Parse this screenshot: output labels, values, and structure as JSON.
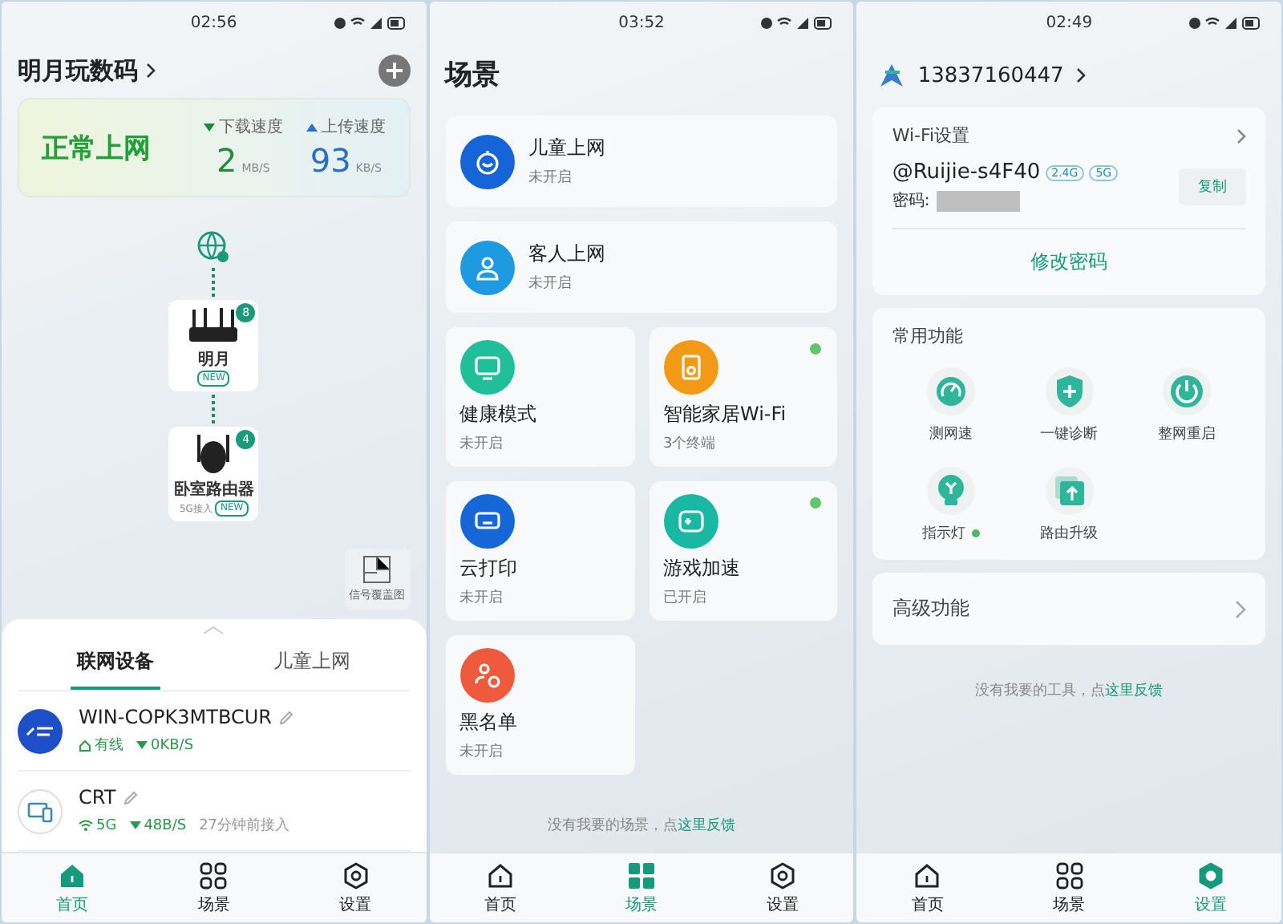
{
  "home": {
    "status_bar": {
      "time": "02:56"
    },
    "title": "明月玩数码",
    "summary": {
      "state": "正常上网",
      "download": {
        "label": "下载速度",
        "value": "2",
        "unit": "MB/S"
      },
      "upload": {
        "label": "上传速度",
        "value": "93",
        "unit": "KB/S"
      }
    },
    "nodes": [
      {
        "kind": "router",
        "name": "明月",
        "tag": "NEW",
        "count": "8"
      },
      {
        "kind": "extender",
        "name": "卧室路由器",
        "note": "5G接入",
        "tag": "NEW",
        "count": "4"
      }
    ],
    "coverage_button": "信号覆盖图",
    "tabs": [
      {
        "label": "联网设备",
        "selected": true
      },
      {
        "label": "儿童上网",
        "selected": false
      }
    ],
    "devices": [
      {
        "kind": "logo",
        "name": "WIN-COPK3MTBCUR",
        "link": {
          "kind": "wired",
          "label": "有线"
        },
        "speed": "0KB/S"
      },
      {
        "kind": "computer",
        "name": "CRT",
        "link": {
          "kind": "wifi",
          "label": "5G"
        },
        "speed": "48B/S",
        "time": "27分钟前接入"
      }
    ],
    "nav": [
      {
        "kind": "home",
        "label": "首页",
        "selected": true
      },
      {
        "kind": "scene",
        "label": "场景",
        "selected": false
      },
      {
        "kind": "settings",
        "label": "设置",
        "selected": false
      }
    ]
  },
  "scenes": {
    "status_bar": {
      "time": "03:52"
    },
    "title": "场景",
    "cards": [
      {
        "kind": "child",
        "wide": true,
        "title": "儿童上网",
        "status": "未开启",
        "color": "#1565d8",
        "online": false
      },
      {
        "kind": "guest",
        "wide": true,
        "title": "客人上网",
        "status": "未开启",
        "color": "#1e9be0",
        "online": false
      },
      {
        "kind": "health",
        "wide": false,
        "title": "健康模式",
        "status": "未开启",
        "color": "#1fbf9a",
        "online": false
      },
      {
        "kind": "smart",
        "wide": false,
        "title": "智能家居Wi-Fi",
        "status": "3个终端",
        "color": "#f29a16",
        "online": true
      },
      {
        "kind": "print",
        "wide": false,
        "title": "云打印",
        "status": "未开启",
        "color": "#1566d6",
        "online": false
      },
      {
        "kind": "game",
        "wide": false,
        "title": "游戏加速",
        "status": "已开启",
        "color": "#19b8a3",
        "online": true
      },
      {
        "kind": "block",
        "wide": false,
        "title": "黑名单",
        "status": "未开启",
        "color": "#ef5a3c",
        "online": false
      }
    ],
    "footer": {
      "text": "没有我要的场景，点",
      "link": "这里反馈"
    },
    "nav": [
      {
        "kind": "home",
        "label": "首页",
        "selected": false
      },
      {
        "kind": "scene",
        "label": "场景",
        "selected": true
      },
      {
        "kind": "settings",
        "label": "设置",
        "selected": false
      }
    ]
  },
  "settings": {
    "status_bar": {
      "time": "02:49"
    },
    "account": "13837160447",
    "wifi": {
      "title": "Wi-Fi设置",
      "ssid": "@Ruijie-s4F40",
      "bands": [
        "2.4G",
        "5G"
      ],
      "password_label": "密码:",
      "copy": "复制",
      "change": "修改密码"
    },
    "common": {
      "title": "常用功能",
      "items": [
        {
          "kind": "speed",
          "label": "测网速",
          "on": false
        },
        {
          "kind": "diagnose",
          "label": "一键诊断",
          "on": false
        },
        {
          "kind": "restart",
          "label": "整网重启",
          "on": false
        },
        {
          "kind": "light",
          "label": "指示灯",
          "on": true
        },
        {
          "kind": "upgrade",
          "label": "路由升级",
          "on": false
        }
      ]
    },
    "advanced": "高级功能",
    "footer": {
      "text": "没有我要的工具，点",
      "link": "这里反馈"
    },
    "nav": [
      {
        "kind": "home",
        "label": "首页",
        "selected": false
      },
      {
        "kind": "scene",
        "label": "场景",
        "selected": false
      },
      {
        "kind": "settings",
        "label": "设置",
        "selected": true
      }
    ]
  }
}
